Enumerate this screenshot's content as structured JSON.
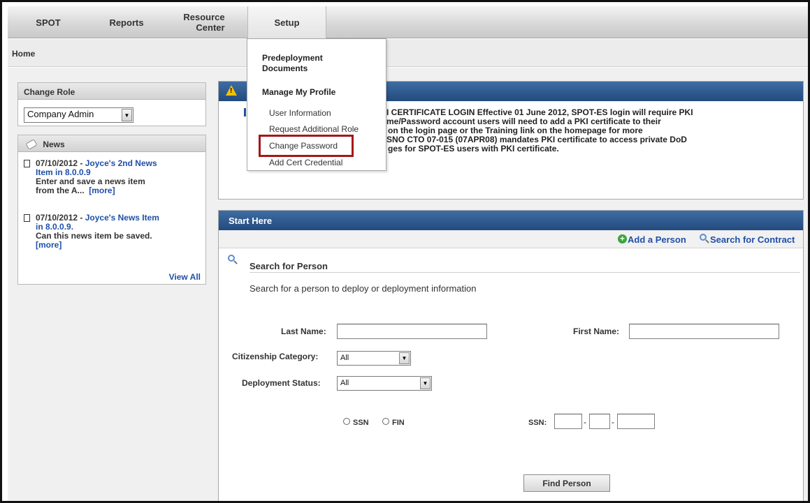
{
  "nav": {
    "tabs": [
      "SPOT",
      "Reports",
      "Resource Center",
      "Setup"
    ],
    "resource_line1": "Resource",
    "resource_line2": "Center"
  },
  "breadcrumb": "Home",
  "change_role": {
    "title": "Change Role",
    "selected": "Company Admin"
  },
  "news": {
    "title": "News",
    "items": [
      {
        "date": "07/10/2012",
        "sep": " - ",
        "title_a": "Joyce's 2nd News",
        "title_b": "Item in 8.0.0.9",
        "body_a": "Enter and save a news item",
        "body_b": "from the A...",
        "more": "[more]"
      },
      {
        "date": "07/10/2012",
        "sep": " - ",
        "title_a": "Joyce's News Item",
        "title_b": "in 8.0.0.9.",
        "body_a": "Can this news item be saved.",
        "more": "[more]"
      }
    ],
    "view_all": "View All"
  },
  "notice": {
    "lines": [
      "I CERTIFICATE LOGIN Effective 01 June 2012, SPOT-ES login will require PKI",
      "me/Password account users will need to add a PKI certificate to their",
      "on the login page or the Training link on the homepage for more",
      "SNO CTO 07-015 (07APR08) mandates PKI certificate to access private DoD",
      "ges for SPOT-ES users with PKI certificate."
    ]
  },
  "setup_menu": {
    "heading1_a": "Predeployment",
    "heading1_b": "Documents",
    "heading2": "Manage My Profile",
    "items": [
      "User Information",
      "Request Additional Role",
      "Change Password",
      "Add Cert Credential"
    ]
  },
  "start_here": {
    "title": "Start Here",
    "add_person": "Add a Person",
    "search_contract": "Search for Contract",
    "search_heading": "Search for Person",
    "search_desc": "Search for a person to deploy or deployment information",
    "last_name_label": "Last Name:",
    "first_name_label": "First Name:",
    "citizenship_label": "Citizenship Category:",
    "citizenship_value": "All",
    "deploy_status_label": "Deployment Status:",
    "deploy_status_value": "All",
    "ssn_option": "SSN",
    "fin_option": "FIN",
    "ssn_label": "SSN:",
    "find_button": "Find Person"
  },
  "colors": {
    "panel_header": "#2d5a91",
    "link": "#1f4fa8",
    "highlight": "#a3181a",
    "warning": "#f2c200",
    "add_icon": "#3aa63a"
  },
  "icons": [
    "warning-icon",
    "news-icon",
    "document-icon",
    "add-icon",
    "search-icon",
    "magnifier-icon",
    "dropdown-arrow-icon"
  ]
}
